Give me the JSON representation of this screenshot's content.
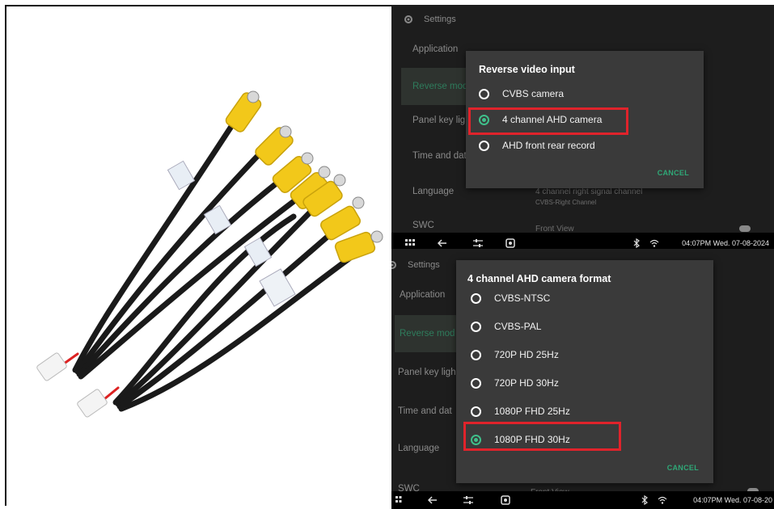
{
  "screen1": {
    "header": "Settings",
    "menu": [
      "Application",
      "Reverse mod",
      "Panel key ligh",
      "Time and dat",
      "Language",
      "SWC"
    ],
    "background_text": [
      "4 channel right signal channel",
      "CVBS-Right Channel",
      "Front View"
    ],
    "dialog": {
      "title": "Reverse video input",
      "options": [
        {
          "label": "CVBS camera",
          "checked": false
        },
        {
          "label": "4 channel AHD camera",
          "checked": true
        },
        {
          "label": "AHD front rear record",
          "checked": false
        }
      ],
      "cancel": "CANCEL"
    },
    "status_time": "04:07PM Wed. 07-08-2024"
  },
  "screen2": {
    "header": "Settings",
    "menu": [
      "Application",
      "Reverse mod",
      "Panel key ligh",
      "Time and dat",
      "Language",
      "SWC"
    ],
    "background_text": [
      "Front View"
    ],
    "dialog": {
      "title": "4 channel AHD camera format",
      "options": [
        {
          "label": "CVBS-NTSC",
          "checked": false
        },
        {
          "label": "CVBS-PAL",
          "checked": false
        },
        {
          "label": "720P HD 25Hz",
          "checked": false
        },
        {
          "label": "720P HD 30Hz",
          "checked": false
        },
        {
          "label": "1080P FHD 25Hz",
          "checked": false
        },
        {
          "label": "1080P FHD 30Hz",
          "checked": true
        }
      ],
      "cancel": "CANCEL"
    },
    "status_time": "04:07PM Wed. 07-08-20"
  },
  "icons": [
    "gear-icon",
    "grid-icon",
    "back-arrow-icon",
    "sliders-icon",
    "square-app-icon",
    "bluetooth-icon",
    "wifi-icon"
  ],
  "colors": {
    "accent": "#3fbf8a",
    "highlight": "#e0232b",
    "dialog": "#3a3a3a",
    "screen": "#1d1d1d"
  }
}
